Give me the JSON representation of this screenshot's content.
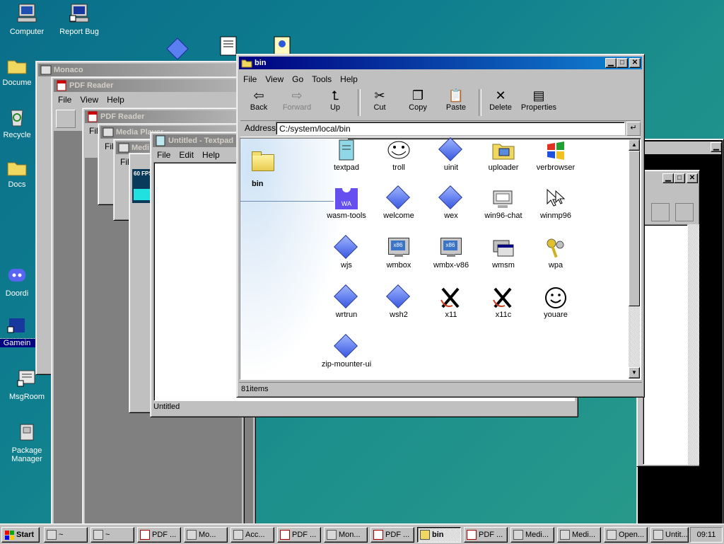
{
  "desktop": {
    "icons": [
      {
        "label": "Computer"
      },
      {
        "label": "Report Bug"
      },
      {
        "label": "Docume"
      },
      {
        "label": "Recycle"
      },
      {
        "label": "Docs"
      },
      {
        "label": "Doordi"
      },
      {
        "label": "Gamein"
      },
      {
        "label": "MsgRoom"
      },
      {
        "label": "Package Manager"
      }
    ]
  },
  "bg_windows": {
    "monaco": "Monaco",
    "pdf1": "PDF Reader",
    "pdf2": "PDF Reader",
    "media": "Media Player",
    "media2": "Medi",
    "fps": "60 FPS",
    "textpad_title": "Untitled - Textpad",
    "textpad_status": "Untitled",
    "menu_file": "File",
    "menu_edit": "Edit",
    "menu_view": "View",
    "menu_help": "Help"
  },
  "explorer": {
    "title": "bin",
    "menu": [
      "File",
      "View",
      "Go",
      "Tools",
      "Help"
    ],
    "toolbar": {
      "back": "Back",
      "forward": "Forward",
      "up": "Up",
      "cut": "Cut",
      "copy": "Copy",
      "paste": "Paste",
      "delete": "Delete",
      "properties": "Properties"
    },
    "address_label": "Address",
    "address_value": "C:/system/local/bin",
    "sidebar_title": "bin",
    "status": "81items",
    "items": [
      {
        "label": "textpad",
        "icon": "notepad-icon"
      },
      {
        "label": "troll",
        "icon": "troll-face-icon"
      },
      {
        "label": "uinit",
        "icon": "diamond-icon"
      },
      {
        "label": "uploader",
        "icon": "uploader-icon"
      },
      {
        "label": "verbrowser",
        "icon": "windows-flag-icon"
      },
      {
        "label": "wasm-tools",
        "icon": "wasm-icon"
      },
      {
        "label": "welcome",
        "icon": "diamond-icon"
      },
      {
        "label": "wex",
        "icon": "diamond-icon"
      },
      {
        "label": "win96-chat",
        "icon": "chat-icon"
      },
      {
        "label": "winmp96",
        "icon": "cursor-icon"
      },
      {
        "label": "wjs",
        "icon": "diamond-icon"
      },
      {
        "label": "wmbox",
        "icon": "x86-monitor-icon"
      },
      {
        "label": "wmbx-v86",
        "icon": "x86-monitor-icon"
      },
      {
        "label": "wmsm",
        "icon": "windows-stack-icon"
      },
      {
        "label": "wpa",
        "icon": "keys-icon"
      },
      {
        "label": "wrtrun",
        "icon": "diamond-icon"
      },
      {
        "label": "wsh2",
        "icon": "diamond-icon"
      },
      {
        "label": "x11",
        "icon": "x11-icon"
      },
      {
        "label": "x11c",
        "icon": "x11-icon"
      },
      {
        "label": "youare",
        "icon": "smiley-icon"
      },
      {
        "label": "zip-mounter-ui",
        "icon": "diamond-icon"
      }
    ]
  },
  "taskbar": {
    "start": "Start",
    "tasks": [
      "~",
      "~",
      "PDF ...",
      "Mo...",
      "Acc...",
      "PDF ...",
      "Mon...",
      "PDF ...",
      "bin",
      "PDF ...",
      "Medi...",
      "Medi...",
      "Open...",
      "Untit..."
    ],
    "clock": "09:11"
  },
  "colors": {
    "title_active": "#000080",
    "desktop": "#0f7f8f",
    "face": "#c0c0c0"
  }
}
